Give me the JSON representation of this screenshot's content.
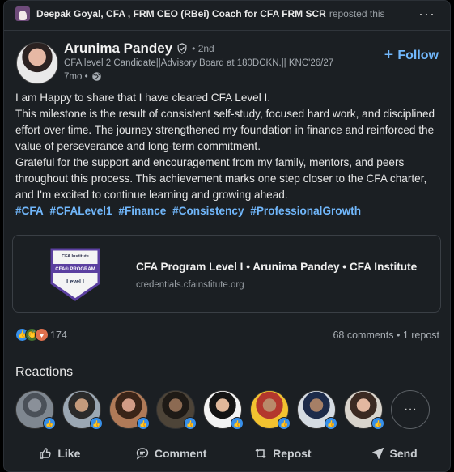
{
  "repost": {
    "actor": "Deepak Goyal, CFA , FRM CEO (RBei) Coach for CFA FRM SCR",
    "action": "reposted this"
  },
  "author": {
    "name": "Arunima Pandey",
    "degree": "• 2nd",
    "headline": "CFA level 2 Candidate||Advisory Board at 180DCKN.|| KNC'26/27",
    "time": "7mo •"
  },
  "follow_label": "Follow",
  "post": {
    "lines": [
      "I am Happy to share that I have cleared CFA Level I.",
      "This milestone is the result of consistent self-study, focused hard work, and disciplined effort over time. The journey strengthened my foundation in finance and reinforced the value of perseverance and long-term commitment.",
      "Grateful for the support and encouragement from my family, mentors, and peers throughout this process. This achievement marks one step closer to the CFA charter, and I'm excited to continue learning and growing ahead."
    ],
    "hashtags": [
      "#CFA",
      "#CFALevel1",
      "#Finance",
      "#Consistency",
      "#ProfessionalGrowth"
    ]
  },
  "credential": {
    "badge_top": "CFA Institute",
    "badge_mid": "CFA® PROGRAM",
    "badge_level": "Level I",
    "title": "CFA Program Level I • Arunima Pandey • CFA Institute",
    "url": "credentials.cfainstitute.org"
  },
  "social": {
    "reaction_count": "174",
    "comments": "68 comments • 1 repost"
  },
  "reactions_title": "Reactions",
  "actions": {
    "like": "Like",
    "comment": "Comment",
    "repost": "Repost",
    "send": "Send"
  },
  "colors": {
    "accent": "#71b7fb",
    "card_bg": "#1b1f23",
    "like_blue": "#378fe9"
  }
}
